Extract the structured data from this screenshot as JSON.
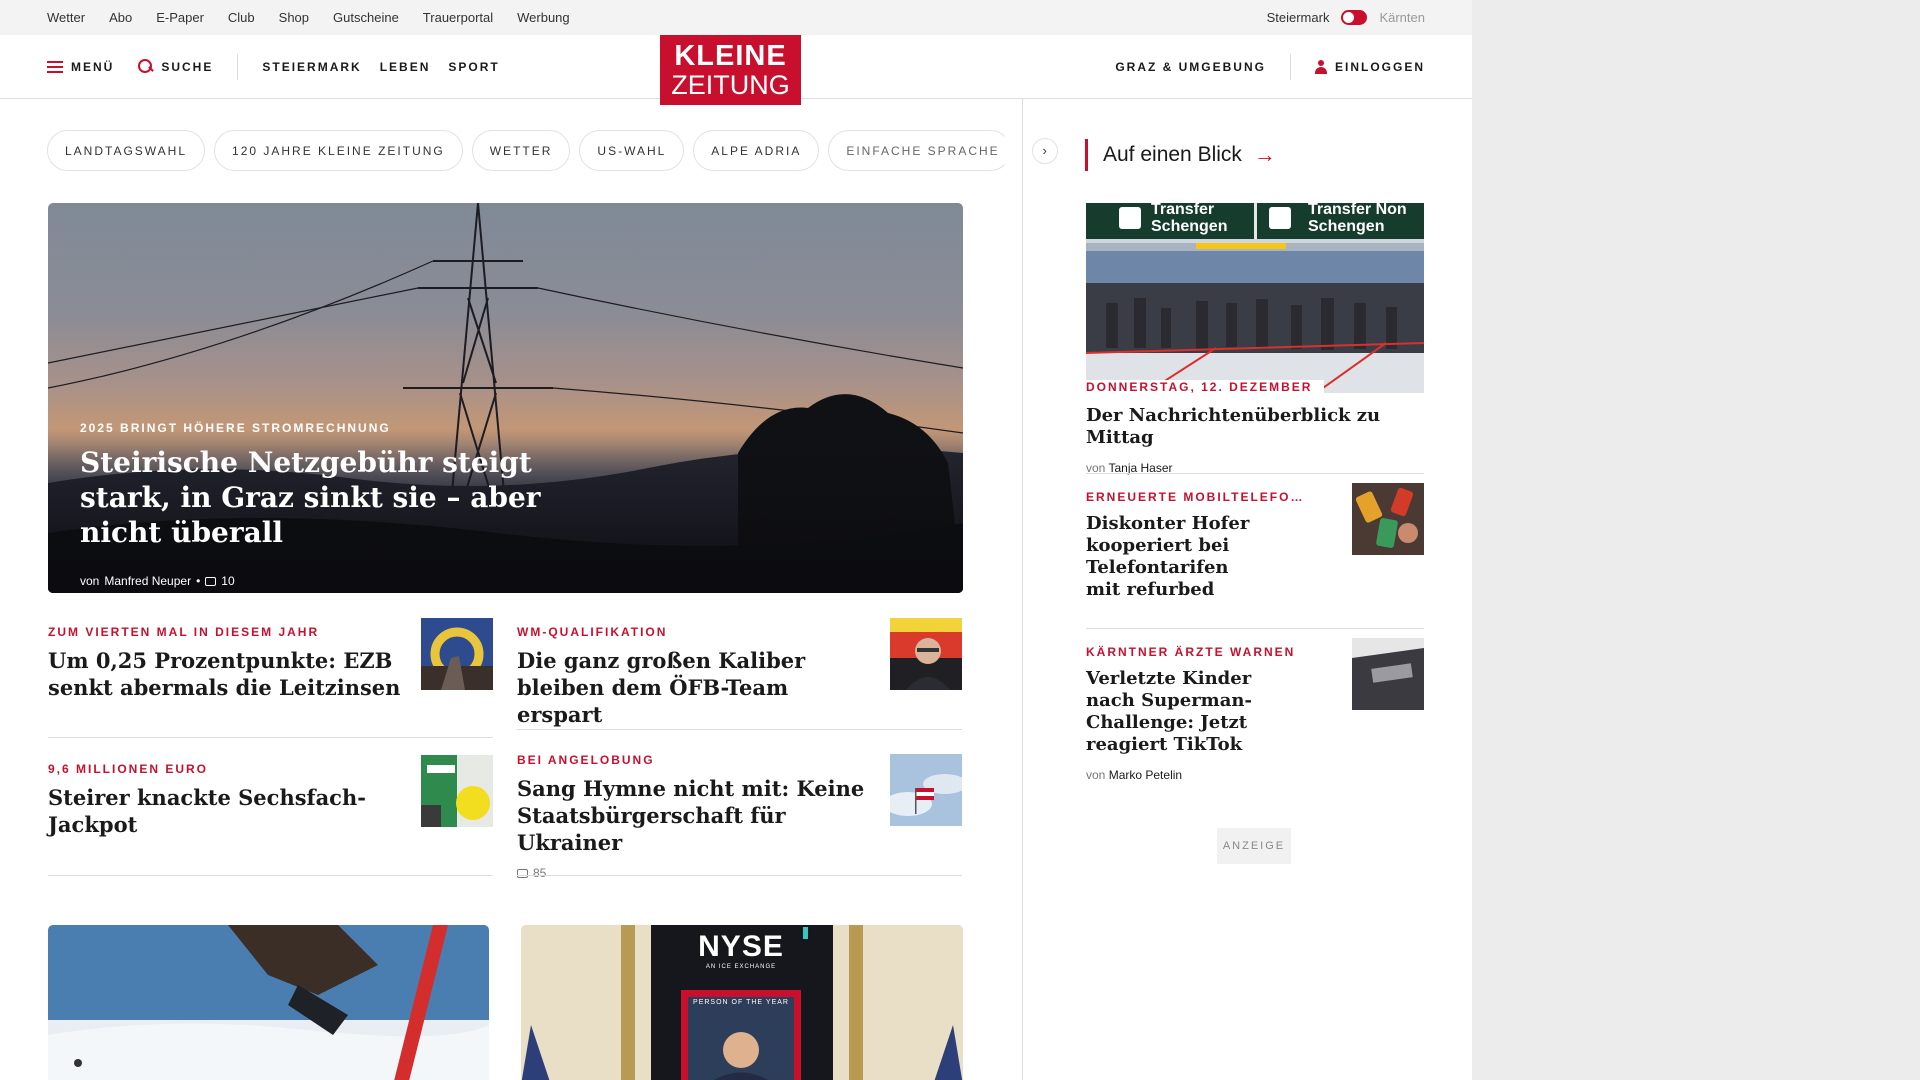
{
  "utilbar": {
    "links": [
      "Wetter",
      "Abo",
      "E-Paper",
      "Club",
      "Shop",
      "Gutscheine",
      "Trauerportal",
      "Werbung"
    ],
    "region_current": "Steiermark",
    "region_alt": "Kärnten"
  },
  "header": {
    "menu": "MENÜ",
    "search": "SUCHE",
    "nav": [
      "STEIERMARK",
      "LEBEN",
      "SPORT"
    ],
    "logo_line1": "KLEINE",
    "logo_line2": "ZEITUNG",
    "local": "GRAZ & UMGEBUNG",
    "login": "EINLOGGEN"
  },
  "tags": [
    "LANDTAGSWAHL",
    "120 JAHRE KLEINE ZEITUNG",
    "WETTER",
    "US-WAHL",
    "ALPE ADRIA",
    "EINFACHE SPRACHE"
  ],
  "tags_next": "›",
  "hero": {
    "kicker": "2025 BRINGT HÖHERE STROMRECHNUNG",
    "title": "Steirische Netzgebühr steigt stark, in Graz sinkt sie – aber nicht überall",
    "by": "von",
    "author": "Manfred Neuper",
    "sep": "•",
    "comments": "10"
  },
  "articles": [
    {
      "kicker": "ZUM VIERTEN MAL IN DIESEM JAHR",
      "title": "Um 0,25 Prozentpunkte: EZB senkt abermals die Leitzinsen"
    },
    {
      "kicker": "WM-QUALIFIKATION",
      "title": "Die ganz großen Kaliber bleiben dem ÖFB-Team erspart"
    },
    {
      "kicker": "9,6 MILLIONEN EURO",
      "title": "Steirer knackte Sechsfach-Jackpot"
    },
    {
      "kicker": "BEI ANGELOBUNG",
      "title": "Sang Hymne nicht mit: Keine Staatsbürgerschaft für Ukrainer",
      "comments": "85"
    }
  ],
  "cards": {
    "nyse_logo": "NYSE",
    "nyse_sub": "AN ICE EXCHANGE",
    "time_label": "PERSON OF THE YEAR"
  },
  "sidebar": {
    "heading": "Auf einen Blick",
    "arrow": "→",
    "sign_left": "Transfer Schengen",
    "sign_right": "Transfer Non Schengen",
    "articles": [
      {
        "kicker": "DONNERSTAG, 12. DEZEMBER",
        "title": "Der Nachrichtenüberblick zu Mittag",
        "by": "von",
        "author": "Tanja Haser"
      },
      {
        "kicker": "ERNEUERTE MOBILTELEFO…",
        "title": "Diskonter Hofer kooperiert bei Telefontarifen mit refurbed"
      },
      {
        "kicker": "KÄRNTNER ÄRZTE WARNEN",
        "title": "Verletzte Kinder nach Superman-Challenge: Jetzt reagiert TikTok",
        "by": "von",
        "author": "Marko Petelin"
      }
    ],
    "ad_label": "ANZEIGE"
  },
  "colors": {
    "brand_red": "#c8102e"
  }
}
